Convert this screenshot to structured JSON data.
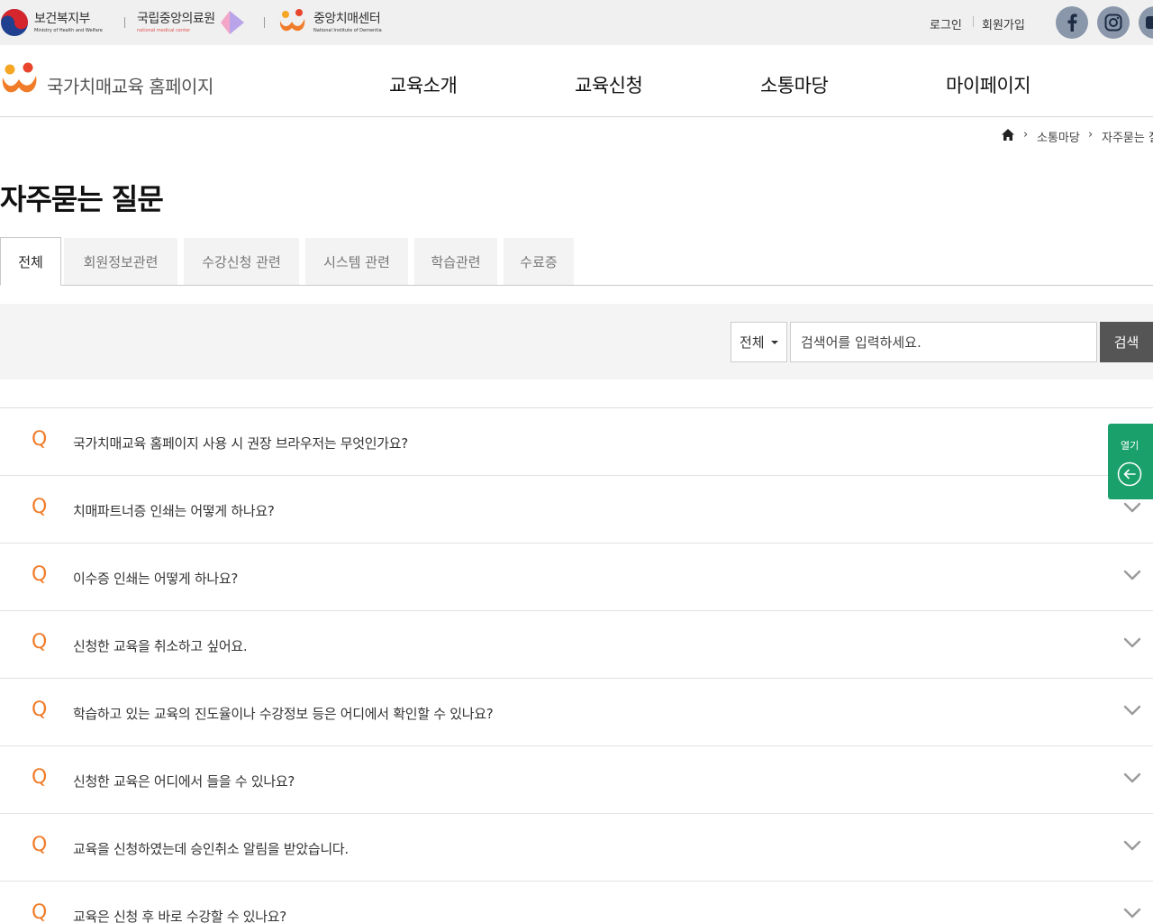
{
  "partners": [
    {
      "name": "보건복지부",
      "sub": "Ministry of Health and Welfare"
    },
    {
      "name": "국립중앙의료원",
      "sub": "national medical center"
    },
    {
      "name": "중앙치매센터",
      "sub": "National Institute of Dementia"
    }
  ],
  "util": {
    "login": "로그인",
    "signup": "회원가입"
  },
  "sns": [
    {
      "icon": "facebook-icon"
    },
    {
      "icon": "instagram-icon"
    }
  ],
  "site_title": "국가치매교육 홈페이지",
  "gnb": [
    "교육소개",
    "교육신청",
    "소통마당",
    "마이페이지"
  ],
  "breadcrumb": {
    "items": [
      "소통마당",
      "자주묻는 질문"
    ]
  },
  "page_title": "자주묻는 질문",
  "tabs": [
    "전체",
    "회원정보관련",
    "수강신청 관련",
    "시스템 관련",
    "학습관련",
    "수료증"
  ],
  "search": {
    "select_value": "전체",
    "placeholder": "검색어를 입력하세요.",
    "button": "검색"
  },
  "faq": {
    "q_mark": "Q",
    "items": [
      "국가치매교육 홈페이지 사용 시 권장 브라우저는 무엇인가요?",
      "치매파트너증 인쇄는 어떻게 하나요?",
      "이수증 인쇄는 어떻게 하나요?",
      "신청한 교육을 취소하고 싶어요.",
      "학습하고 있는 교육의 진도율이나 수강정보 등은 어디에서 확인할 수 있나요?",
      "신청한 교육은 어디에서 들을 수 있나요?",
      "교육을 신청하였는데 승인취소 알림을 받았습니다.",
      "교육은 신청 후 바로 수강할 수 있나요?"
    ]
  },
  "float_panel": {
    "label": "열기"
  },
  "colors": {
    "accent_orange": "#f07c2a",
    "float_green": "#1aa06b",
    "search_btn": "#555555"
  }
}
